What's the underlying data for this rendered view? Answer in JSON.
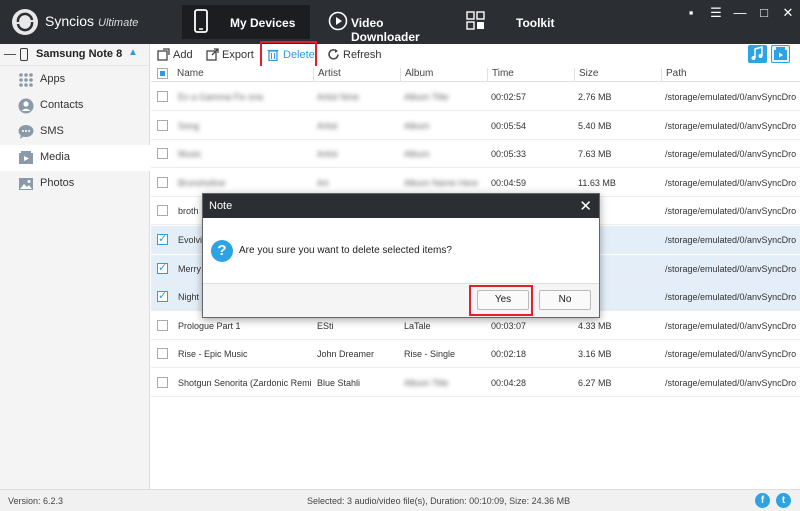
{
  "app": {
    "name": "Syncios",
    "edition": "Ultimate"
  },
  "nav": {
    "tabs": [
      {
        "label": "My Devices"
      },
      {
        "label": "Video Downloader"
      },
      {
        "label": "Toolkit"
      }
    ]
  },
  "window_controls": {
    "chat": "▪",
    "menu": "☰",
    "minimize": "—",
    "maximize": "□",
    "close": "✕"
  },
  "sidebar": {
    "device": "Samsung Note 8",
    "items": [
      {
        "label": "Apps",
        "icon": "apps-grid-icon"
      },
      {
        "label": "Contacts",
        "icon": "contacts-icon"
      },
      {
        "label": "SMS",
        "icon": "sms-bubble-icon"
      },
      {
        "label": "Media",
        "icon": "media-film-icon"
      },
      {
        "label": "Photos",
        "icon": "photos-icon"
      }
    ]
  },
  "toolbar": {
    "add": "Add",
    "export": "Export",
    "delete": "Delete",
    "refresh": "Refresh"
  },
  "table": {
    "headers": [
      "Name",
      "Artist",
      "Album",
      "Time",
      "Size",
      "Path"
    ],
    "rows": [
      {
        "name": "En a Gamma Fix ona",
        "artist": "Artist Nme",
        "album": "Album Title",
        "time": "00:02:57",
        "size": "2.76 MB",
        "path": "/storage/emulated/0/anvSyncDro",
        "checked": false,
        "blurred": true
      },
      {
        "name": "Song",
        "artist": "Artist",
        "album": "Album",
        "time": "00:05:54",
        "size": "5.40 MB",
        "path": "/storage/emulated/0/anvSyncDro",
        "checked": false,
        "blurred": true
      },
      {
        "name": "Music",
        "artist": "Artist",
        "album": "Album",
        "time": "00:05:33",
        "size": "7.63 MB",
        "path": "/storage/emulated/0/anvSyncDro",
        "checked": false,
        "blurred": true
      },
      {
        "name": "Brunsholine",
        "artist": "Art",
        "album": "Album Name Here",
        "time": "00:04:59",
        "size": "11.63 MB",
        "path": "/storage/emulated/0/anvSyncDro",
        "checked": false,
        "blurred": true
      },
      {
        "name": "broth",
        "artist": "",
        "album": "",
        "time": "",
        "size": "",
        "path": "/storage/emulated/0/anvSyncDro",
        "checked": false,
        "blurred": false
      },
      {
        "name": "Evolvi",
        "artist": "",
        "album": "",
        "time": "",
        "size": "",
        "path": "/storage/emulated/0/anvSyncDro",
        "checked": true,
        "blurred": false
      },
      {
        "name": "Merry",
        "artist": "",
        "album": "",
        "time": "",
        "size": "",
        "path": "/storage/emulated/0/anvSyncDro",
        "checked": true,
        "blurred": false
      },
      {
        "name": "Night",
        "artist": "",
        "album": "",
        "time": "",
        "size": "",
        "path": "/storage/emulated/0/anvSyncDro",
        "checked": true,
        "blurred": false
      },
      {
        "name": "Prologue Part 1",
        "artist": "ESti",
        "album": "LaTale",
        "time": "00:03:07",
        "size": "4.33 MB",
        "path": "/storage/emulated/0/anvSyncDro",
        "checked": false,
        "blurred": false
      },
      {
        "name": "Rise - Epic Music",
        "artist": "John Dreamer",
        "album": "Rise - Single",
        "time": "00:02:18",
        "size": "3.16 MB",
        "path": "/storage/emulated/0/anvSyncDro",
        "checked": false,
        "blurred": false
      },
      {
        "name": "Shotgun Senorita (Zardonic Remix)",
        "artist": "Blue Stahli",
        "album": "Album Title",
        "time": "00:04:28",
        "size": "6.27 MB",
        "path": "/storage/emulated/0/anvSyncDro",
        "checked": false,
        "blurred": false,
        "album_blurred": true
      }
    ]
  },
  "dialog": {
    "title": "Note",
    "close": "✕",
    "message": "Are you sure you want to delete selected items?",
    "yes": "Yes",
    "no": "No"
  },
  "status": {
    "version": "Version: 6.2.3",
    "summary": "Selected: 3 audio/video file(s), Duration: 00:10:09, Size: 24.36 MB"
  },
  "colors": {
    "accent": "#2c9ee0",
    "titlebar": "#2b2e33",
    "highlight": "#e0202a"
  }
}
